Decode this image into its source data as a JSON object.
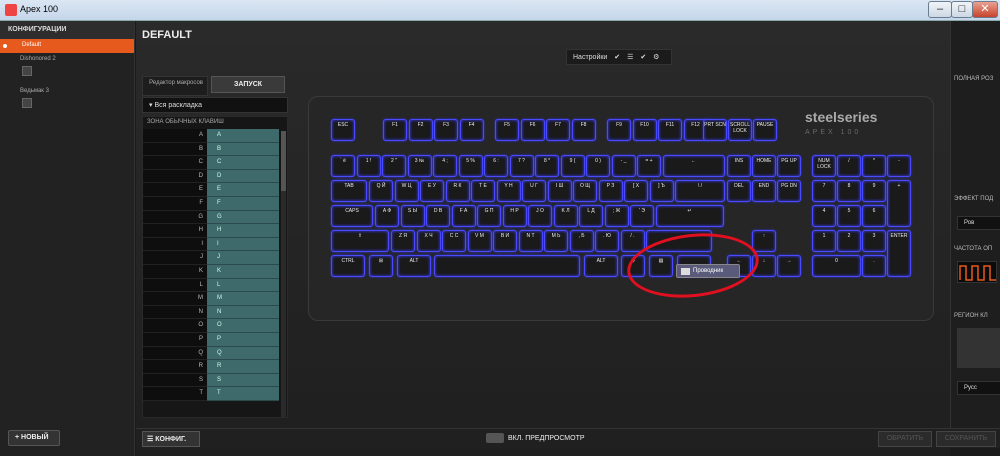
{
  "window": {
    "title": "Apex 100",
    "min": "–",
    "max": "□",
    "close": "✕"
  },
  "sidebar": {
    "header": "КОНФИГУРАЦИИ",
    "items": [
      {
        "label": "Default",
        "active": true
      },
      {
        "label": "Dishonored 2"
      },
      {
        "label": "Ведьмак 3"
      }
    ],
    "new_button": "+ НОВЫЙ"
  },
  "main": {
    "title": "DEFAULT",
    "settings_label": "Настройки",
    "macro_editor": "Редактор макросов",
    "launch": "ЗАПУСК",
    "layout_select": "Вся раскладка",
    "zone_title": "ЗОНА ОБЫЧНЫХ КЛАВИШ",
    "zone_rows": [
      [
        "A",
        "A"
      ],
      [
        "B",
        "B"
      ],
      [
        "C",
        "C"
      ],
      [
        "D",
        "D"
      ],
      [
        "E",
        "E"
      ],
      [
        "F",
        "F"
      ],
      [
        "G",
        "G"
      ],
      [
        "H",
        "H"
      ],
      [
        "I",
        "I"
      ],
      [
        "J",
        "J"
      ],
      [
        "K",
        "K"
      ],
      [
        "L",
        "L"
      ],
      [
        "M",
        "M"
      ],
      [
        "N",
        "N"
      ],
      [
        "O",
        "O"
      ],
      [
        "P",
        "P"
      ],
      [
        "Q",
        "Q"
      ],
      [
        "R",
        "R"
      ],
      [
        "S",
        "S"
      ],
      [
        "T",
        "T"
      ]
    ]
  },
  "keyboard": {
    "brand": "steelseries",
    "brand_sub": "APEX 100",
    "keys": {
      "esc": "ESC",
      "f": [
        "F1",
        "F2",
        "F3",
        "F4",
        "F5",
        "F6",
        "F7",
        "F8",
        "F9",
        "F10",
        "F11",
        "F12"
      ],
      "prt": "PRT SCN",
      "scroll": "SCROLL LOCK",
      "pause": "PAUSE",
      "num_row": [
        "` ё",
        "1 !",
        "2 \"",
        "3 №",
        "4 ;",
        "5 %",
        "6 :",
        "7 ?",
        "8 *",
        "9 (",
        "0 )",
        "- _",
        "= +",
        "←"
      ],
      "ins": "INS",
      "home": "HOME",
      "pgup": "PG UP",
      "numlock": "NUM LOCK",
      "np_div": "/",
      "np_mul": "*",
      "np_minus": "-",
      "tab": "TAB",
      "q_row": [
        "Q Й",
        "W Ц",
        "E У",
        "R К",
        "T Е",
        "Y Н",
        "U Г",
        "I Ш",
        "O Щ",
        "P З",
        "[ Х",
        "] Ъ",
        "\\ /"
      ],
      "del": "DEL",
      "end": "END",
      "pgdn": "PG DN",
      "np7": "7",
      "np8": "8",
      "np9": "9",
      "np_plus": "+",
      "caps": "CAPS",
      "a_row": [
        "A Ф",
        "S Ы",
        "D В",
        "F А",
        "G П",
        "H Р",
        "J О",
        "K Л",
        "L Д",
        "; Ж",
        "' Э"
      ],
      "enter": "↵",
      "np4": "4",
      "np5": "5",
      "np6": "6",
      "shift": "⇧",
      "z_row": [
        "Z Я",
        "X Ч",
        "C С",
        "V М",
        "B И",
        "N Т",
        "M Ь",
        ", Б",
        ". Ю",
        "/ ."
      ],
      "rshift": "",
      "up": "↑",
      "np1": "1",
      "np2": "2",
      "np3": "3",
      "np_enter": "ENTER",
      "ctrl": "CTRL",
      "win": "⊞",
      "alt": "ALT",
      "space": "",
      "altgr": "ALT",
      "fn": "⚙",
      "menu": "▤",
      "rctrl": "",
      "left": "←",
      "down": "↓",
      "right": "→",
      "np0": "0",
      "np_dot": "."
    },
    "tooltip": "Проводник"
  },
  "bottom": {
    "config_button": "☰ КОНФИГ.",
    "preview": "ВКЛ. ПРЕДПРОСМОТР",
    "revert": "ОБРАТИТЬ",
    "save": "СОХРАНИТЬ"
  },
  "right_panel": {
    "full": "ПОЛНАЯ РОЗ",
    "effect": "ЭФФЕКТ ПОД",
    "effect_value": "Ров",
    "freq": "ЧАСТОТА ОП",
    "region": "РЕГИОН КЛ",
    "region_value": "Русс"
  }
}
